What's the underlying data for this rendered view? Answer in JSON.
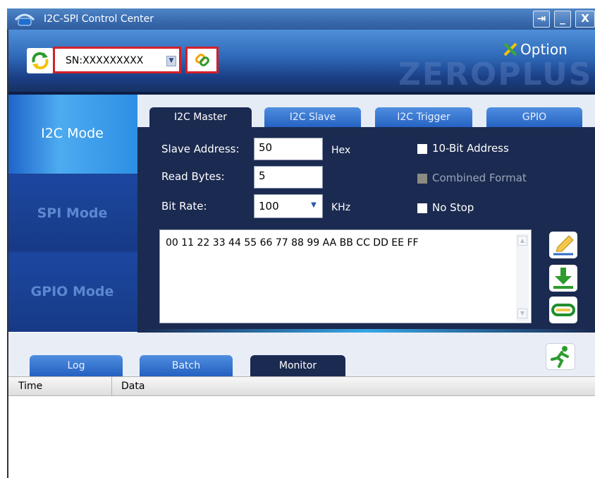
{
  "window": {
    "title": "I2C-SPI Control Center",
    "controls": {
      "restore_glyph": "⇥",
      "minimize_glyph": "_",
      "close_glyph": "X"
    }
  },
  "header": {
    "serial_value": "SN:XXXXXXXXX",
    "option_label": "Option",
    "brand_text": "ZEROPLUS"
  },
  "modes": [
    {
      "label": "I2C Mode",
      "active": true
    },
    {
      "label": "SPI Mode",
      "active": false
    },
    {
      "label": "GPIO Mode",
      "active": false
    }
  ],
  "tabs": [
    {
      "label": "I2C Master",
      "active": true
    },
    {
      "label": "I2C Slave",
      "active": false
    },
    {
      "label": "I2C Trigger",
      "active": false
    },
    {
      "label": "GPIO",
      "active": false
    }
  ],
  "form": {
    "slave_address_label": "Slave Address:",
    "slave_address_value": "50",
    "slave_address_unit": "Hex",
    "read_bytes_label": "Read Bytes:",
    "read_bytes_value": "5",
    "bit_rate_label": "Bit Rate:",
    "bit_rate_value": "100",
    "bit_rate_unit": "KHz"
  },
  "options": {
    "ten_bit_label": "10-Bit Address",
    "ten_bit_checked": false,
    "combined_label": "Combined Format",
    "combined_enabled": false,
    "no_stop_label": "No Stop",
    "no_stop_checked": false
  },
  "data_text": "00 11 22 33 44 55 66 77 88 99 AA BB CC DD EE FF",
  "bottom_tabs": [
    {
      "label": "Log",
      "active": false
    },
    {
      "label": "Batch",
      "active": false
    },
    {
      "label": "Monitor",
      "active": true
    }
  ],
  "table": {
    "columns": [
      "Time",
      "Data"
    ],
    "rows": []
  },
  "colors": {
    "accent": "#2d67b6",
    "highlight_border": "#d3202a",
    "panel": "#1b2a50"
  }
}
